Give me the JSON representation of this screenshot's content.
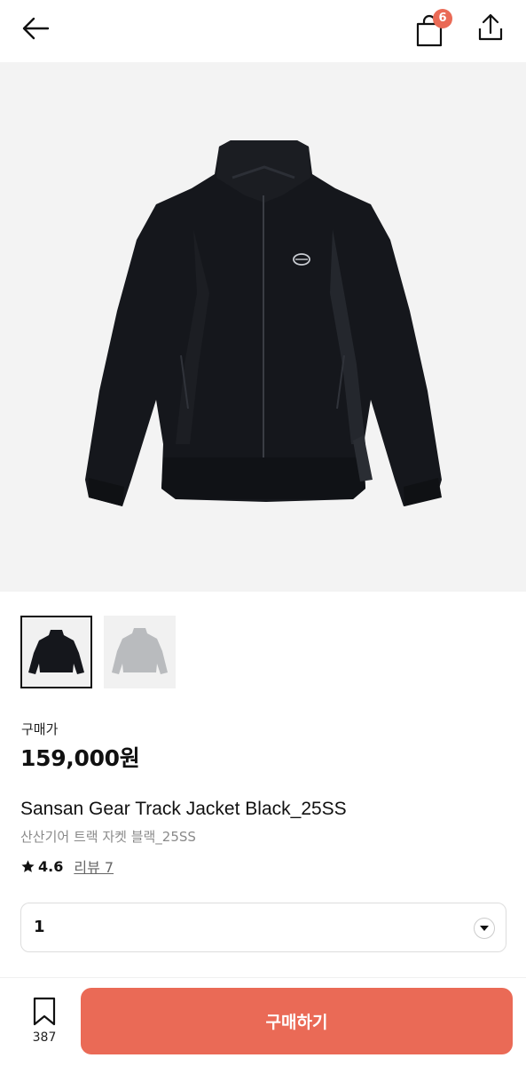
{
  "header": {
    "back_icon": "arrow-left-icon",
    "cart_icon": "shopping-bag-icon",
    "cart_count": "6",
    "share_icon": "share-upload-icon"
  },
  "product": {
    "hero_color": "black",
    "thumbnails": [
      {
        "color": "black",
        "active": true
      },
      {
        "color": "gray",
        "active": false
      }
    ],
    "price_label": "구매가",
    "price": "159,000원",
    "title_en": "Sansan Gear Track Jacket Black_25SS",
    "title_ko": "산산기어 트랙 자켓 블랙_25SS",
    "rating_icon": "star-icon",
    "rating": "4.6",
    "review_link": "리뷰 7"
  },
  "quantity": {
    "value": "1",
    "arrow_icon": "chevron-down-icon"
  },
  "bottom_bar": {
    "bookmark_icon": "bookmark-icon",
    "bookmark_count": "387",
    "buy_label": "구매하기",
    "accent_color": "#ea6a56"
  }
}
